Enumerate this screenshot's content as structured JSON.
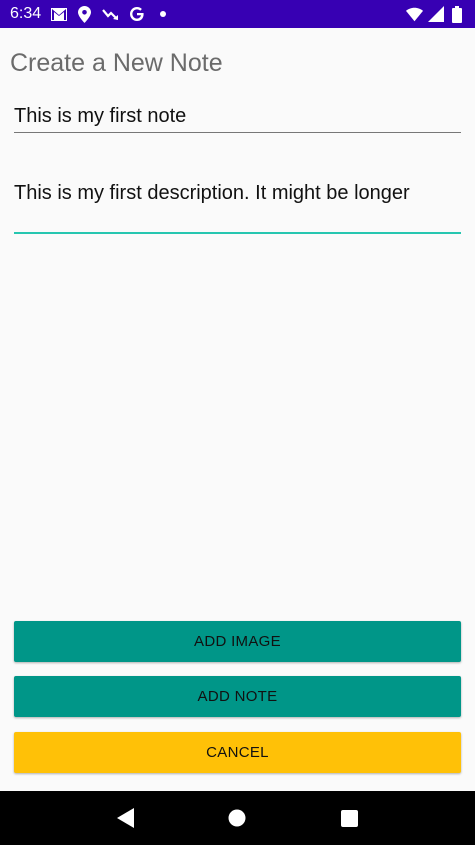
{
  "status_bar": {
    "time": "6:34",
    "left_icons": [
      "gmail-icon",
      "location-icon",
      "trending-icon",
      "google-icon",
      "dot-icon"
    ],
    "right_icons": [
      "wifi-icon",
      "signal-icon",
      "battery-icon"
    ],
    "background": "#3700b3"
  },
  "page": {
    "title": "Create a New Note"
  },
  "form": {
    "title_value": "This is my first note",
    "description_value": "This is my first description. It might be longer",
    "accent_color": "#26c6b0"
  },
  "buttons": {
    "add_image": "ADD IMAGE",
    "add_note": "ADD NOTE",
    "cancel": "CANCEL",
    "primary_color": "#009688",
    "cancel_color": "#ffc107"
  },
  "nav_bar": {
    "icons": [
      "back-icon",
      "home-icon",
      "recents-icon"
    ]
  }
}
